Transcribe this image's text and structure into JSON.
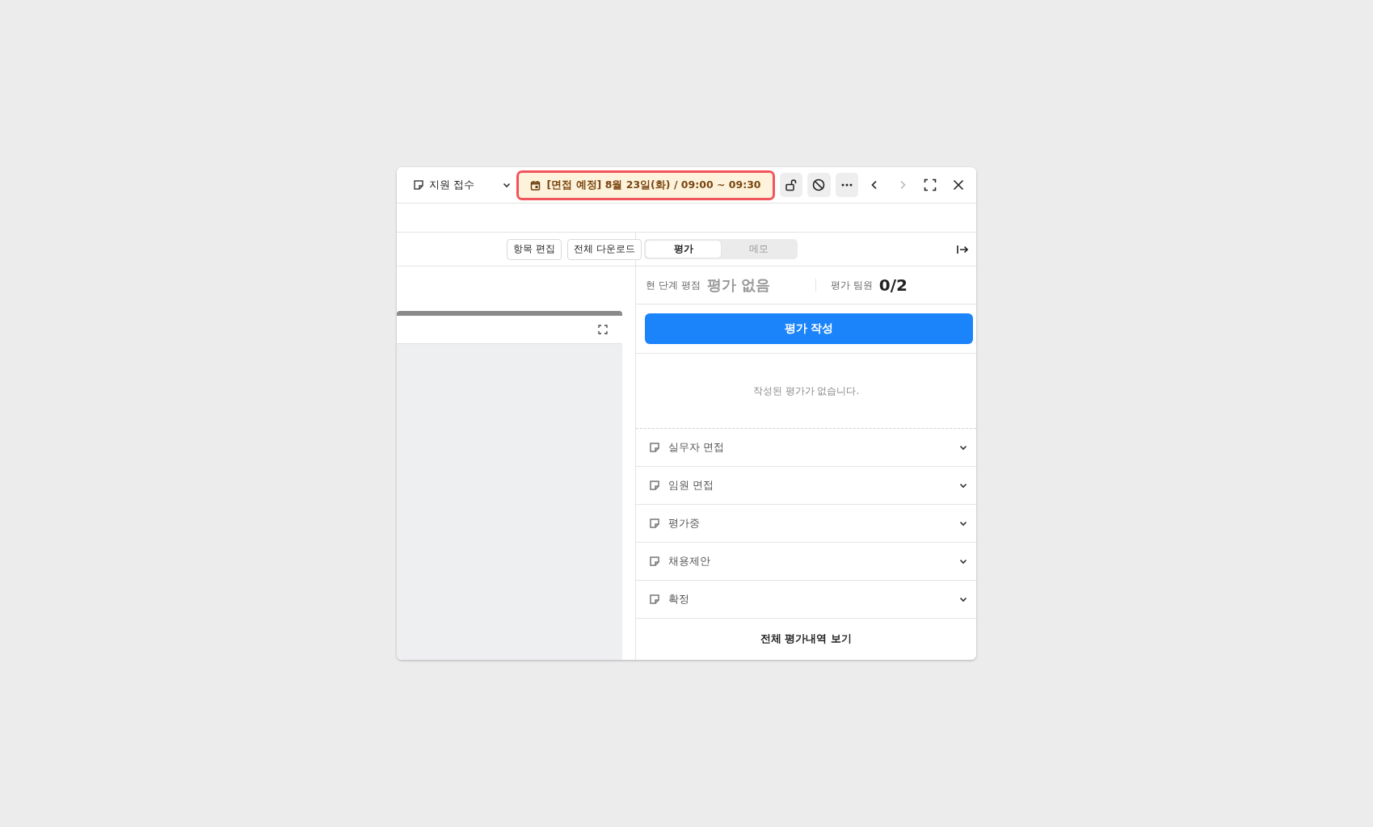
{
  "header": {
    "stage_dropdown": "지원 접수",
    "schedule_badge": "[면접 예정] 8월 23일(화) / 09:00 ~ 09:30",
    "prev_disabled": false,
    "next_disabled": true
  },
  "toolbar_buttons": [
    "항목 편집",
    "전체 다운로드"
  ],
  "tabs": [
    {
      "label": "평가",
      "selected": true
    },
    {
      "label": "메모",
      "selected": false
    }
  ],
  "score": {
    "label": "현 단계 평점",
    "value": "평가 없음",
    "team_label": "평가 팀원",
    "team_value": "0/2"
  },
  "write_button": "평가 작성",
  "empty_message": "작성된 평가가 없습니다.",
  "stages": [
    {
      "label": "실무자 면접",
      "expanded": false
    },
    {
      "label": "임원 면접",
      "expanded": false
    },
    {
      "label": "평가중",
      "expanded": false
    },
    {
      "label": "채용제안",
      "expanded": false
    },
    {
      "label": "확정",
      "expanded": false
    }
  ],
  "footer_link": "전체 평가내역 보기"
}
